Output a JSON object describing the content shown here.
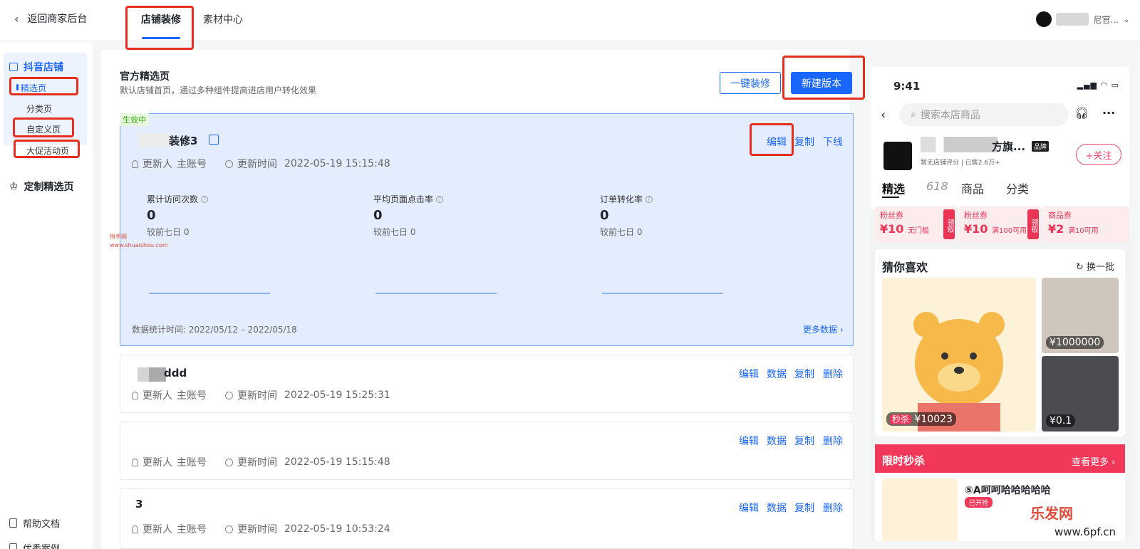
{
  "topbar": {
    "back_label": "返回商家后台",
    "tabs": [
      "店铺装修",
      "素材中心"
    ],
    "user_suffix": "尼官..."
  },
  "sidebar": {
    "douyin": "抖音店铺",
    "items": [
      "精选页",
      "分类页",
      "自定义页",
      "大促活动页"
    ],
    "custom": "定制精选页",
    "help": "帮助文档",
    "cases": "优秀案例"
  },
  "main": {
    "title": "官方精选页",
    "subtitle": "默认店铺首页，通过多种组件提高进店用户转化效果",
    "btn_oneclick": "一键装修",
    "btn_new": "新建版本",
    "active": {
      "badge": "生效中",
      "name": "装修3",
      "actions": [
        "编辑",
        "复制",
        "下线"
      ],
      "updater_label": "更新人",
      "updater": "主账号",
      "time_label": "更新时间",
      "time": "2022-05-19 15:15:48",
      "stats": [
        {
          "label": "累计访问次数",
          "value": "0",
          "cmp": "较前七日 0"
        },
        {
          "label": "平均页面点击率",
          "value": "0",
          "cmp": "较前七日 0"
        },
        {
          "label": "订单转化率",
          "value": "0",
          "cmp": "较前七日 0"
        }
      ],
      "footer": "数据统计时间:  2022/05/12 – 2022/05/18",
      "more": "更多数据 ›"
    },
    "cards": [
      {
        "name": "ddd",
        "time": "2022-05-19 15:25:31"
      },
      {
        "name": "",
        "time": "2022-05-19 15:15:48"
      },
      {
        "name": "3",
        "time": "2022-05-19 10:53:24"
      }
    ],
    "card_actions": [
      "编辑",
      "数据",
      "复制",
      "删除"
    ],
    "watermark": [
      "甩手网",
      "www.shuaishou.com"
    ]
  },
  "phone": {
    "time": "9:41",
    "search": "搜索本店商品",
    "shop_name": "方旗...",
    "brand": "品牌",
    "score": "暂无店铺评分 | 已售2.6万+",
    "follow": "+关注",
    "tabs": [
      "精选",
      "618",
      "商品",
      "分类"
    ],
    "coupons": [
      {
        "title": "粉丝券",
        "value": "¥10",
        "cond": "无门槛"
      },
      {
        "title": "粉丝券",
        "value": "¥10",
        "cond": "满100可用"
      },
      {
        "title": "商品券",
        "value": "¥2",
        "cond": "满10可用"
      }
    ],
    "coupon_get": "领取",
    "like_title": "猜你喜欢",
    "refresh": "换一批",
    "prices": [
      "¥10023",
      "¥1000000",
      "¥0.1"
    ],
    "flash_tag": "秒杀",
    "flash_title": "限时秒杀",
    "flash_more": "查看更多 ›",
    "flash_item": "⑤A呵呵哈哈哈哈哈",
    "flash_state": "已开抢"
  },
  "watermark2": [
    "乐发网",
    "www.6pf.cn"
  ]
}
